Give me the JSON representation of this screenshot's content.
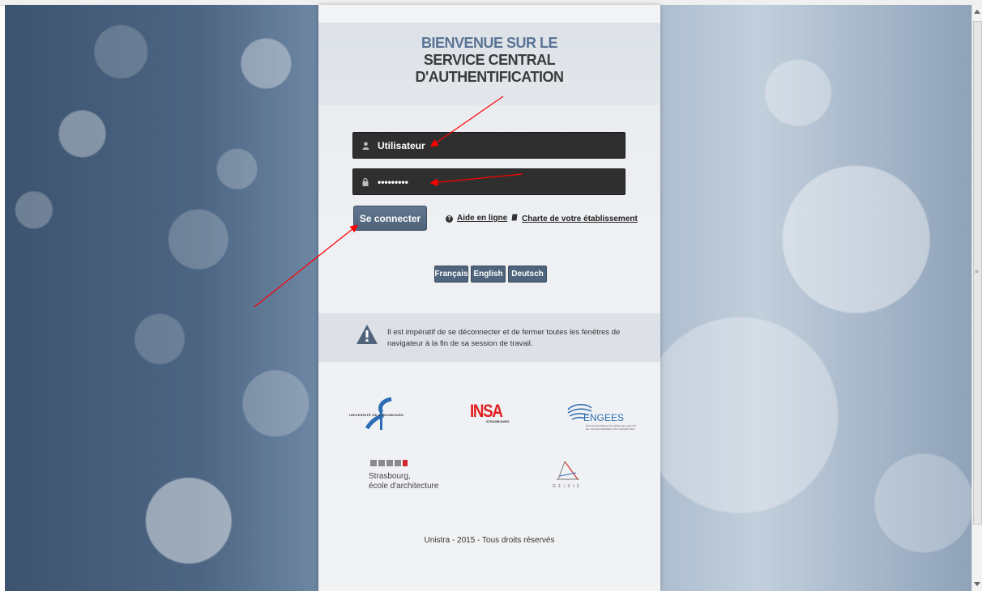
{
  "header": {
    "title_line1": "BIENVENUE SUR LE",
    "title_line2": "SERVICE CENTRAL",
    "title_line3": "D'AUTHENTIFICATION"
  },
  "login": {
    "username_value": "Utilisateur",
    "password_value": "•••••••••",
    "username_icon": "user-icon",
    "password_icon": "lock-icon",
    "submit_label": "Se connecter"
  },
  "links": {
    "help_label": "Aide en ligne",
    "charter_label": "Charte de votre établissement"
  },
  "languages": [
    {
      "label": "Français"
    },
    {
      "label": "English"
    },
    {
      "label": "Deutsch"
    }
  ],
  "warning": {
    "text": "Il est impératif de se déconnecter et de fermer toutes les fenêtres de navigateur à la fin de sa session de travail.",
    "icon": "warning-icon"
  },
  "logos": {
    "uds": "UNIVERSITÉ DE STRASBOURG",
    "insa": "INSA",
    "insa_sub": "STRASBOURG",
    "engees": "ENGEES",
    "engees_sub": "ÉCOLE NATIONALE DU GÉNIE DE L'EAU ET DE L'ENVIRONNEMENT DE STRASBOURG",
    "arch_line1": "Strasbourg,",
    "arch_line2": "école d'architecture",
    "gstu": "G Σ / X I Σ"
  },
  "footer": {
    "text": "Unistra - 2015 - Tous droits réservés"
  },
  "colors": {
    "title_accent": "#5a7494",
    "button": "#56697f",
    "field_bg": "#2f2f2f",
    "annotation_arrow": "#ff0000"
  }
}
